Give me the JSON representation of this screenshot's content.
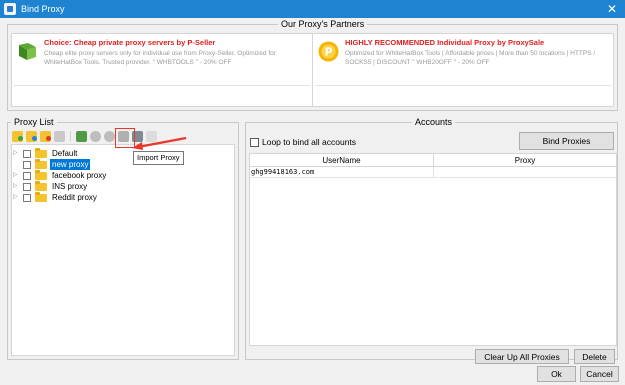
{
  "window": {
    "title": "Bind Proxy",
    "close_symbol": "✕"
  },
  "partners": {
    "title": "Our Proxy's Partners",
    "ads": [
      {
        "headline": "Choice: Cheap private proxy servers by P-Seller",
        "description": "Cheap elite proxy servers only for individual use from Proxy-Seller. Optimized for WhiteHatBox Tools. Trusted provider. \" WHBTOOLS \" - 20% OFF",
        "logo_icon": "proxy-seller-logo",
        "accent": "#e02020"
      },
      {
        "headline": "HIGHLY RECOMMENDED Individual Proxy by ProxySale",
        "description": "Optimized for WhiteHatBox Tools | Affordable prices | More than 50 locations | HTTPS / SOCKS5 | DISCOUNT \" WHB20OFF \" - 20% OFF",
        "logo_icon": "proxysale-logo",
        "accent": "#e02020"
      }
    ]
  },
  "proxy_list": {
    "title": "Proxy List",
    "toolbar": [
      "add-folder-icon",
      "open-folder-icon",
      "delete-folder-icon",
      "edit-icon",
      "export-icon",
      "back-icon",
      "forward-icon",
      "settings-icon",
      "import-proxy-icon",
      "refresh-icon"
    ],
    "tooltip": "Import Proxy",
    "highlight_color": "#e8372d",
    "items": [
      {
        "label": "Default",
        "selected": false
      },
      {
        "label": "new proxy",
        "selected": true
      },
      {
        "label": "facebook proxy",
        "selected": false
      },
      {
        "label": "INS proxy",
        "selected": false
      },
      {
        "label": "Reddit proxy",
        "selected": false
      }
    ]
  },
  "accounts": {
    "title": "Accounts",
    "loop_label": "Loop to bind all accounts",
    "bind_button": "Bind Proxies",
    "columns": {
      "username": "UserName",
      "proxy": "Proxy"
    },
    "rows": [
      {
        "username": "ghg99418163.com",
        "proxy": ""
      }
    ],
    "clear_button": "Clear Up All Proxies",
    "delete_button": "Delete"
  },
  "footer": {
    "ok": "Ok",
    "cancel": "Cancel"
  },
  "colors": {
    "titlebar": "#1e84d2",
    "selection": "#0078d7",
    "folder": "#f5c32c"
  }
}
